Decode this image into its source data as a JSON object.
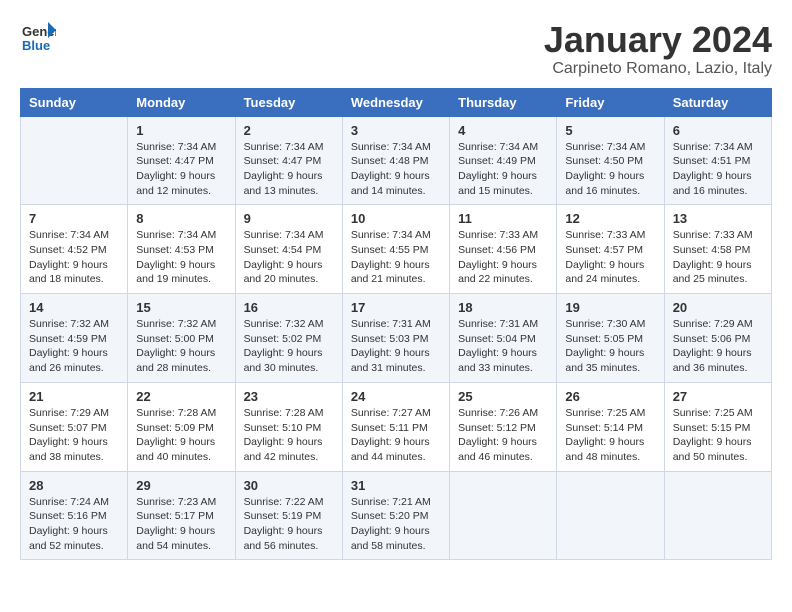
{
  "logo": {
    "line1": "General",
    "line2": "Blue"
  },
  "title": "January 2024",
  "location": "Carpineto Romano, Lazio, Italy",
  "days_of_week": [
    "Sunday",
    "Monday",
    "Tuesday",
    "Wednesday",
    "Thursday",
    "Friday",
    "Saturday"
  ],
  "weeks": [
    [
      {
        "day": "",
        "info": ""
      },
      {
        "day": "1",
        "info": "Sunrise: 7:34 AM\nSunset: 4:47 PM\nDaylight: 9 hours\nand 12 minutes."
      },
      {
        "day": "2",
        "info": "Sunrise: 7:34 AM\nSunset: 4:47 PM\nDaylight: 9 hours\nand 13 minutes."
      },
      {
        "day": "3",
        "info": "Sunrise: 7:34 AM\nSunset: 4:48 PM\nDaylight: 9 hours\nand 14 minutes."
      },
      {
        "day": "4",
        "info": "Sunrise: 7:34 AM\nSunset: 4:49 PM\nDaylight: 9 hours\nand 15 minutes."
      },
      {
        "day": "5",
        "info": "Sunrise: 7:34 AM\nSunset: 4:50 PM\nDaylight: 9 hours\nand 16 minutes."
      },
      {
        "day": "6",
        "info": "Sunrise: 7:34 AM\nSunset: 4:51 PM\nDaylight: 9 hours\nand 16 minutes."
      }
    ],
    [
      {
        "day": "7",
        "info": "Sunrise: 7:34 AM\nSunset: 4:52 PM\nDaylight: 9 hours\nand 18 minutes."
      },
      {
        "day": "8",
        "info": "Sunrise: 7:34 AM\nSunset: 4:53 PM\nDaylight: 9 hours\nand 19 minutes."
      },
      {
        "day": "9",
        "info": "Sunrise: 7:34 AM\nSunset: 4:54 PM\nDaylight: 9 hours\nand 20 minutes."
      },
      {
        "day": "10",
        "info": "Sunrise: 7:34 AM\nSunset: 4:55 PM\nDaylight: 9 hours\nand 21 minutes."
      },
      {
        "day": "11",
        "info": "Sunrise: 7:33 AM\nSunset: 4:56 PM\nDaylight: 9 hours\nand 22 minutes."
      },
      {
        "day": "12",
        "info": "Sunrise: 7:33 AM\nSunset: 4:57 PM\nDaylight: 9 hours\nand 24 minutes."
      },
      {
        "day": "13",
        "info": "Sunrise: 7:33 AM\nSunset: 4:58 PM\nDaylight: 9 hours\nand 25 minutes."
      }
    ],
    [
      {
        "day": "14",
        "info": "Sunrise: 7:32 AM\nSunset: 4:59 PM\nDaylight: 9 hours\nand 26 minutes."
      },
      {
        "day": "15",
        "info": "Sunrise: 7:32 AM\nSunset: 5:00 PM\nDaylight: 9 hours\nand 28 minutes."
      },
      {
        "day": "16",
        "info": "Sunrise: 7:32 AM\nSunset: 5:02 PM\nDaylight: 9 hours\nand 30 minutes."
      },
      {
        "day": "17",
        "info": "Sunrise: 7:31 AM\nSunset: 5:03 PM\nDaylight: 9 hours\nand 31 minutes."
      },
      {
        "day": "18",
        "info": "Sunrise: 7:31 AM\nSunset: 5:04 PM\nDaylight: 9 hours\nand 33 minutes."
      },
      {
        "day": "19",
        "info": "Sunrise: 7:30 AM\nSunset: 5:05 PM\nDaylight: 9 hours\nand 35 minutes."
      },
      {
        "day": "20",
        "info": "Sunrise: 7:29 AM\nSunset: 5:06 PM\nDaylight: 9 hours\nand 36 minutes."
      }
    ],
    [
      {
        "day": "21",
        "info": "Sunrise: 7:29 AM\nSunset: 5:07 PM\nDaylight: 9 hours\nand 38 minutes."
      },
      {
        "day": "22",
        "info": "Sunrise: 7:28 AM\nSunset: 5:09 PM\nDaylight: 9 hours\nand 40 minutes."
      },
      {
        "day": "23",
        "info": "Sunrise: 7:28 AM\nSunset: 5:10 PM\nDaylight: 9 hours\nand 42 minutes."
      },
      {
        "day": "24",
        "info": "Sunrise: 7:27 AM\nSunset: 5:11 PM\nDaylight: 9 hours\nand 44 minutes."
      },
      {
        "day": "25",
        "info": "Sunrise: 7:26 AM\nSunset: 5:12 PM\nDaylight: 9 hours\nand 46 minutes."
      },
      {
        "day": "26",
        "info": "Sunrise: 7:25 AM\nSunset: 5:14 PM\nDaylight: 9 hours\nand 48 minutes."
      },
      {
        "day": "27",
        "info": "Sunrise: 7:25 AM\nSunset: 5:15 PM\nDaylight: 9 hours\nand 50 minutes."
      }
    ],
    [
      {
        "day": "28",
        "info": "Sunrise: 7:24 AM\nSunset: 5:16 PM\nDaylight: 9 hours\nand 52 minutes."
      },
      {
        "day": "29",
        "info": "Sunrise: 7:23 AM\nSunset: 5:17 PM\nDaylight: 9 hours\nand 54 minutes."
      },
      {
        "day": "30",
        "info": "Sunrise: 7:22 AM\nSunset: 5:19 PM\nDaylight: 9 hours\nand 56 minutes."
      },
      {
        "day": "31",
        "info": "Sunrise: 7:21 AM\nSunset: 5:20 PM\nDaylight: 9 hours\nand 58 minutes."
      },
      {
        "day": "",
        "info": ""
      },
      {
        "day": "",
        "info": ""
      },
      {
        "day": "",
        "info": ""
      }
    ]
  ]
}
